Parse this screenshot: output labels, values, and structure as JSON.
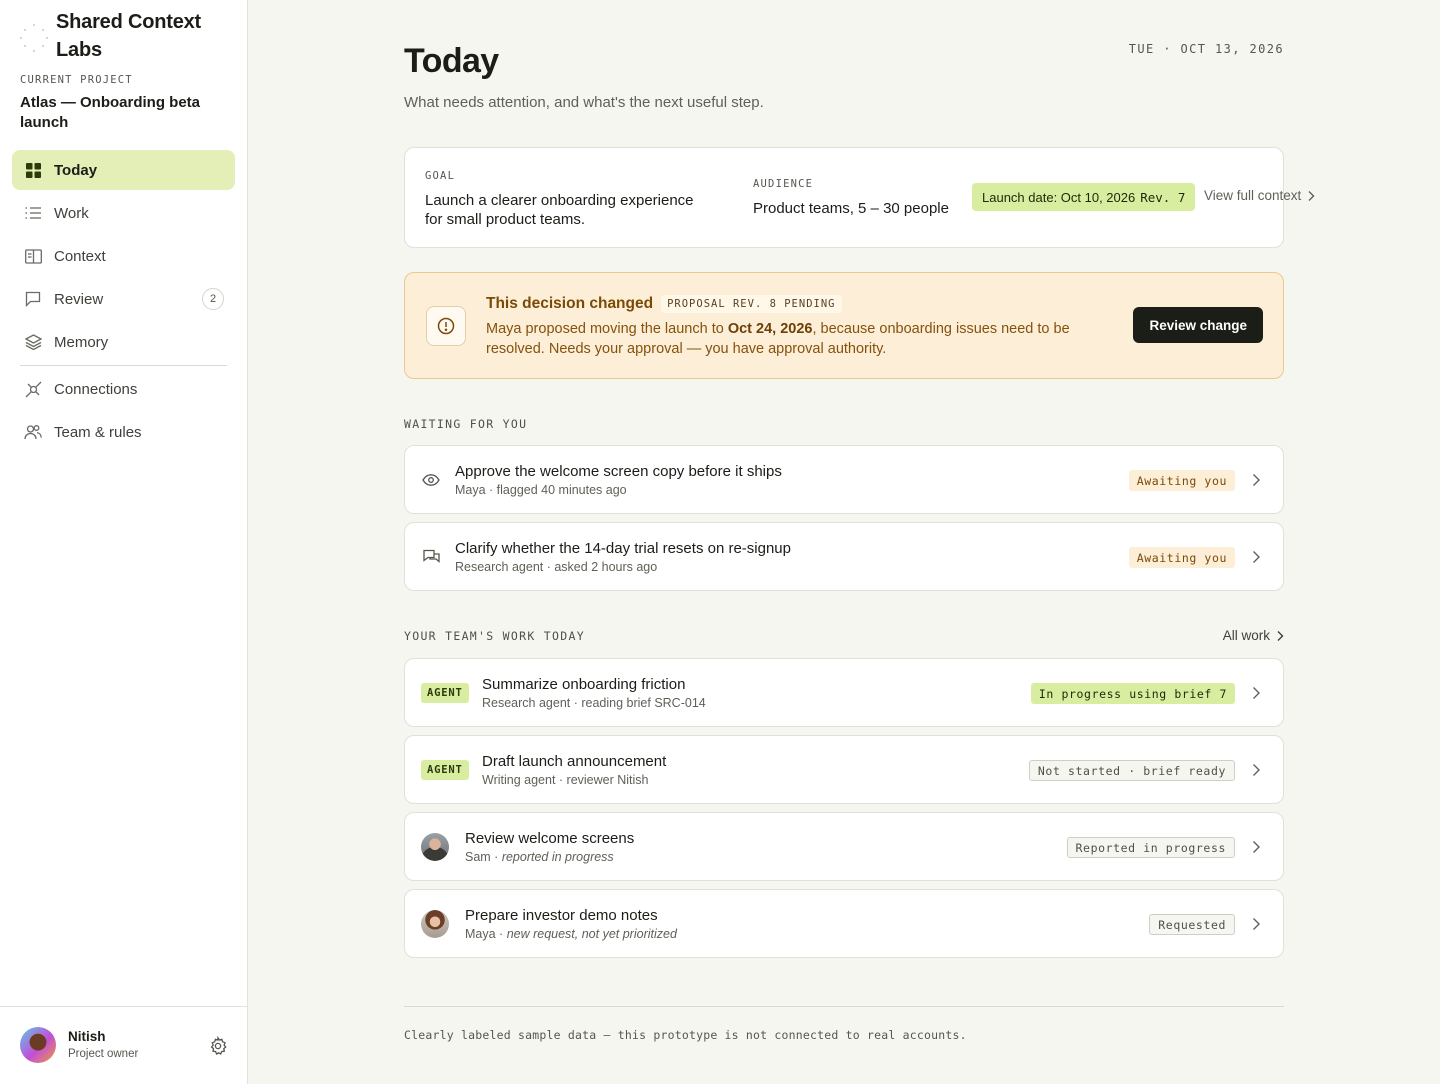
{
  "brand": {
    "name": "Shared Context Labs",
    "logo_icon": "dot-grid-logo-icon"
  },
  "project": {
    "label": "CURRENT PROJECT",
    "name": "Atlas — Onboarding beta launch"
  },
  "nav": {
    "items": [
      {
        "label": "Today",
        "icon": "grid-icon",
        "active": true
      },
      {
        "label": "Work",
        "icon": "list-icon"
      },
      {
        "label": "Context",
        "icon": "book-icon"
      },
      {
        "label": "Review",
        "icon": "review-icon",
        "badge": "2"
      },
      {
        "label": "Memory",
        "icon": "layers-icon"
      },
      {
        "label": "Connections",
        "icon": "plug-icon"
      },
      {
        "label": "Team & rules",
        "icon": "team-icon"
      }
    ]
  },
  "user": {
    "name": "Nitish",
    "role": "Project owner"
  },
  "header": {
    "title": "Today",
    "subtitle": "What needs attention, and what's the next useful step.",
    "date": "TUE · OCT 13, 2026"
  },
  "context_card": {
    "goal_label": "GOAL",
    "goal": "Launch a clearer onboarding experience for small product teams.",
    "audience_label": "AUDIENCE",
    "audience": "Product teams, 5 – 30 people",
    "launch_text": "Launch date: Oct 10, 2026",
    "launch_rev": "Rev. 7",
    "view_link": "View full context"
  },
  "alert": {
    "title": "This decision changed",
    "tag": "PROPOSAL REV. 8 PENDING",
    "body_pre": "Maya proposed moving the launch to ",
    "body_date": "Oct 24, 2026",
    "body_post": ", because onboarding issues need to be resolved. Needs your approval — you have approval authority.",
    "button": "Review change"
  },
  "waiting": {
    "label": "WAITING FOR YOU",
    "items": [
      {
        "icon": "eye-icon",
        "title": "Approve the welcome screen copy before it ships",
        "sub": "Maya · flagged 40 minutes ago",
        "status": "Awaiting you"
      },
      {
        "icon": "chat-icon",
        "title": "Clarify whether the 14-day trial resets on re-signup",
        "sub": "Research agent · asked 2 hours ago",
        "status": "Awaiting you"
      }
    ]
  },
  "team": {
    "label": "YOUR TEAM'S WORK TODAY",
    "all_link": "All work",
    "items": [
      {
        "tag": "AGENT",
        "title": "Summarize onboarding friction",
        "sub": "Research agent · reading brief SRC-014",
        "status": "In progress using brief 7"
      },
      {
        "tag": "AGENT",
        "title": "Draft launch announcement",
        "sub": "Writing agent · reviewer Nitish",
        "status": "Not started · brief ready"
      },
      {
        "person": "Sam",
        "title": "Review welcome screens",
        "sub_name": "Sam · ",
        "sub_note": "reported in progress",
        "status": "Reported in progress"
      },
      {
        "person": "Maya",
        "title": "Prepare investor demo notes",
        "sub_name": "Maya · ",
        "sub_note": "new request, not yet prioritized",
        "status": "Requested"
      }
    ]
  },
  "footer": {
    "text": "Clearly labeled sample data — this prototype is not connected to real accounts."
  },
  "colors": {
    "accent": "#e4efb7",
    "accent_strong": "#d9eda0",
    "warning_bg": "#fdeed7",
    "warning_text": "#7a4a07",
    "ink": "#1b1d17"
  }
}
